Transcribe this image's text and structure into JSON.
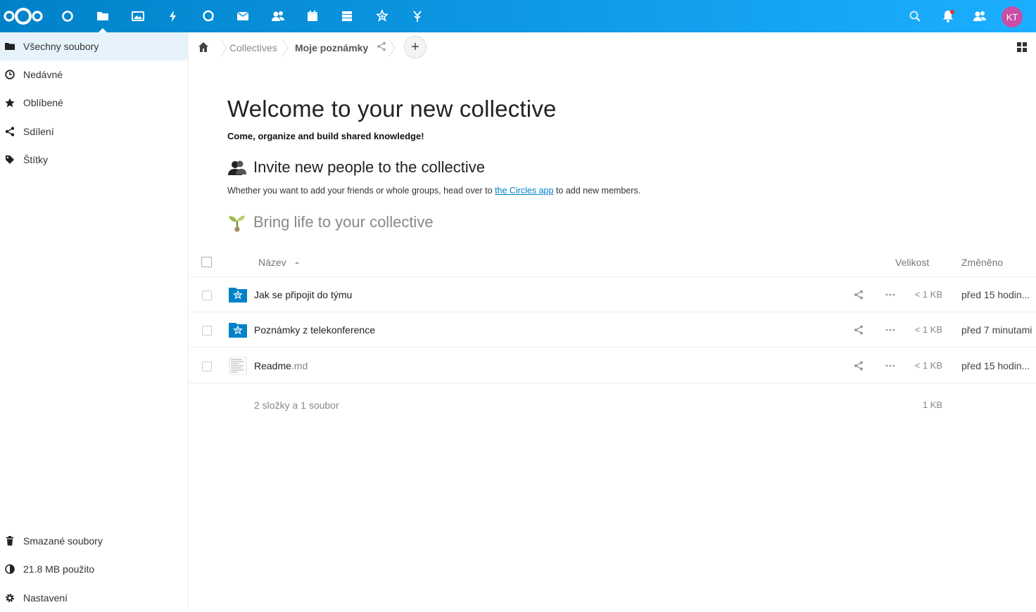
{
  "header": {
    "apps": [
      {
        "name": "dashboard-icon"
      },
      {
        "name": "files-icon",
        "active": true
      },
      {
        "name": "photos-icon"
      },
      {
        "name": "activity-icon"
      },
      {
        "name": "talk-icon"
      },
      {
        "name": "mail-icon"
      },
      {
        "name": "contacts-icon"
      },
      {
        "name": "calendar-icon"
      },
      {
        "name": "deck-icon"
      },
      {
        "name": "collectives-icon"
      },
      {
        "name": "more-apps-icon"
      }
    ],
    "avatar_initials": "KT",
    "accent": "#0082c9",
    "accent_end": "#1cafff"
  },
  "sidebar": {
    "items": [
      {
        "label": "Všechny soubory",
        "icon": "folder-icon",
        "active": true
      },
      {
        "label": "Nedávné",
        "icon": "clock-icon"
      },
      {
        "label": "Oblíbené",
        "icon": "star-icon"
      },
      {
        "label": "Sdílení",
        "icon": "share-icon"
      },
      {
        "label": "Štítky",
        "icon": "tag-icon"
      }
    ],
    "bottom": {
      "trash": "Smazané soubory",
      "quota": "21.8 MB použito",
      "settings": "Nastavení"
    }
  },
  "breadcrumb": {
    "items": [
      "Collectives",
      "Moje poznámky"
    ],
    "add_label": "+"
  },
  "readme": {
    "title": "Welcome to your new collective",
    "lead": "Come, organize and build shared knowledge!",
    "invite_heading": "Invite new people to the collective",
    "invite_text_before": "Whether you want to add your friends or whole groups, head over to ",
    "invite_link": "the Circles app",
    "invite_text_after": " to add new members.",
    "life_heading": "Bring life to your collective"
  },
  "table": {
    "col_name": "Název",
    "col_size": "Velikost",
    "col_modified": "Změněno",
    "rows": [
      {
        "name": "Jak se připojit do týmu",
        "ext": "",
        "size": "< 1 KB",
        "modified": "před 15 hodin...",
        "type": "collective-folder"
      },
      {
        "name": "Poznámky z telekonference",
        "ext": "",
        "size": "< 1 KB",
        "modified": "před 7 minutami",
        "type": "collective-folder"
      },
      {
        "name": "Readme",
        "ext": ".md",
        "size": "< 1 KB",
        "modified": "před 15 hodin...",
        "type": "text-file"
      }
    ],
    "summary": "2 složky a 1 soubor",
    "summary_size": "1 KB"
  }
}
